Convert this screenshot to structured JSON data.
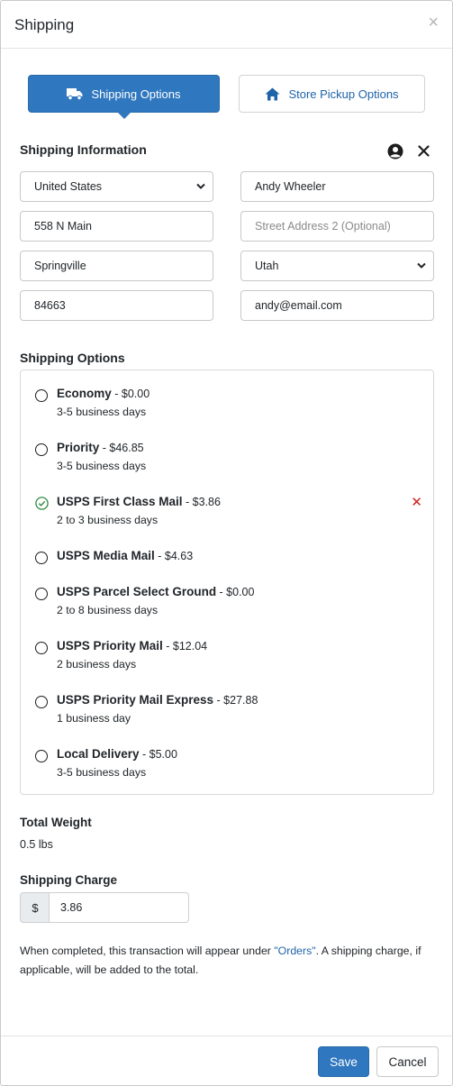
{
  "header": {
    "title": "Shipping",
    "close": "×"
  },
  "tabs": [
    {
      "label": "Shipping Options",
      "icon": "truck-icon",
      "active": true
    },
    {
      "label": "Store Pickup Options",
      "icon": "home-icon",
      "active": false
    }
  ],
  "shipping_info": {
    "title": "Shipping Information",
    "country": "United States",
    "name": "Andy Wheeler",
    "address1": "558 N Main",
    "address2_placeholder": "Street Address 2 (Optional)",
    "city": "Springville",
    "state": "Utah",
    "zip": "84663",
    "email": "andy@email.com"
  },
  "shipping_options": {
    "title": "Shipping Options",
    "items": [
      {
        "name": "Economy",
        "price": " - $0.00",
        "days": "3-5 business days",
        "selected": false
      },
      {
        "name": "Priority",
        "price": " - $46.85",
        "days": "3-5 business days",
        "selected": false
      },
      {
        "name": "USPS First Class Mail",
        "price": " - $3.86",
        "days": "2 to 3 business days",
        "selected": true
      },
      {
        "name": "USPS Media Mail",
        "price": " - $4.63",
        "days": "",
        "selected": false
      },
      {
        "name": "USPS Parcel Select Ground",
        "price": " - $0.00",
        "days": "2 to 8 business days",
        "selected": false
      },
      {
        "name": "USPS Priority Mail",
        "price": " - $12.04",
        "days": "2 business days",
        "selected": false
      },
      {
        "name": "USPS Priority Mail Express",
        "price": " - $27.88",
        "days": "1 business day",
        "selected": false
      },
      {
        "name": "Local Delivery",
        "price": " - $5.00",
        "days": "3-5 business days",
        "selected": false
      }
    ]
  },
  "total_weight": {
    "label": "Total Weight",
    "value": "0.5 lbs"
  },
  "shipping_charge": {
    "label": "Shipping Charge",
    "currency": "$",
    "value": "3.86"
  },
  "note": {
    "before": "When completed, this transaction will appear under ",
    "link": "\"Orders\"",
    "after": ". A shipping charge, if applicable, will be added to the total."
  },
  "footer": {
    "save": "Save",
    "cancel": "Cancel"
  },
  "colors": {
    "primary": "#2f77be",
    "link": "#1f63a8",
    "danger": "#d11f1f",
    "success": "#2e8b3e"
  }
}
